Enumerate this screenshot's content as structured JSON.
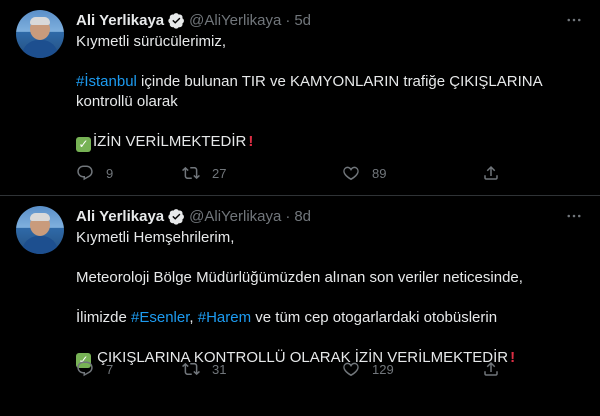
{
  "tweets": [
    {
      "author_name": "Ali Yerlikaya",
      "handle": "@AliYerlikaya",
      "separator": "·",
      "time": "5d",
      "line1": "Kıymetli sürücülerimiz,",
      "p2_hashtag": "#İstanbul",
      "p2_text1": " içinde bulunan TIR ve KAMYONLARIN trafiğe ÇIKIŞLARINA",
      "p2_text2": "kontrollü olarak",
      "p3_text": "İZİN VERİLMEKTEDİR",
      "replies": "9",
      "retweets": "27",
      "likes": "89"
    },
    {
      "author_name": "Ali Yerlikaya",
      "handle": "@AliYerlikaya",
      "separator": "·",
      "time": "8d",
      "line1": "Kıymetli Hemşehrilerim,",
      "p2_text": "Meteoroloji Bölge Müdürlüğümüzden alınan son veriler neticesinde,",
      "p3_prefix": "İlimizde ",
      "p3_hashtag1": "#Esenler",
      "p3_comma": ", ",
      "p3_hashtag2": "#Harem",
      "p3_suffix": " ve tüm cep otogarlardaki otobüslerin",
      "p4_text": " ÇIKIŞLARINA KONTROLLÜ OLARAK İZİN VERİLMEKTEDİR",
      "replies": "7",
      "retweets": "31",
      "likes": "129"
    }
  ],
  "icons": {
    "verified": "verified-badge-icon",
    "more": "more-options-icon",
    "reply": "reply-icon",
    "retweet": "retweet-icon",
    "like": "heart-icon",
    "share": "share-icon",
    "check": "check-mark-emoji",
    "exclamation": "exclamation-emoji"
  },
  "colors": {
    "background": "#000000",
    "text": "#e7e9ea",
    "secondary": "#71767b",
    "link": "#1d9bf0",
    "divider": "#2f3336"
  }
}
